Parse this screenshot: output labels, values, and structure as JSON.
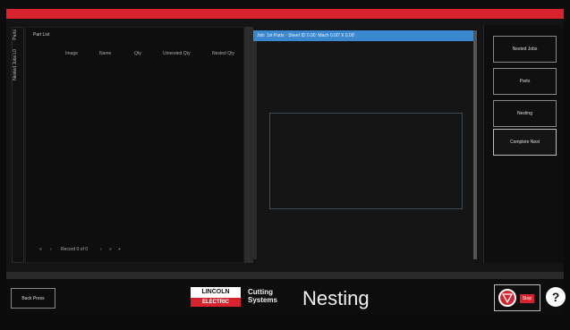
{
  "vertical_tabs": [
    "Parts",
    "Nested Jobs L0"
  ],
  "part_list": {
    "title": "Part List",
    "columns": [
      "Image",
      "Name",
      "Qty",
      "Unnested Qty",
      "Nested Qty"
    ],
    "pager": {
      "first": "«",
      "prev": "‹",
      "record": "Record 0 of 0",
      "next": "›",
      "last": "»",
      "extra": "+"
    }
  },
  "preview": {
    "header": "Job: 1st Parts - Sheet ID 0.00: Mach 0.00' X 0.00'"
  },
  "sidebar": [
    "Nested Jobs",
    "Parts",
    "Nesting",
    "Complete Nest"
  ],
  "footer": {
    "back": "Back Press",
    "brand_top": "LINCOLN",
    "brand_bottom": "ELECTRIC",
    "brand_line1": "Cutting",
    "brand_line2": "Systems",
    "title": "Nesting",
    "estop_label": "Stop",
    "help": "?"
  },
  "colors": {
    "accent_red": "#d8222e",
    "preview_bar": "#3c88d0"
  }
}
